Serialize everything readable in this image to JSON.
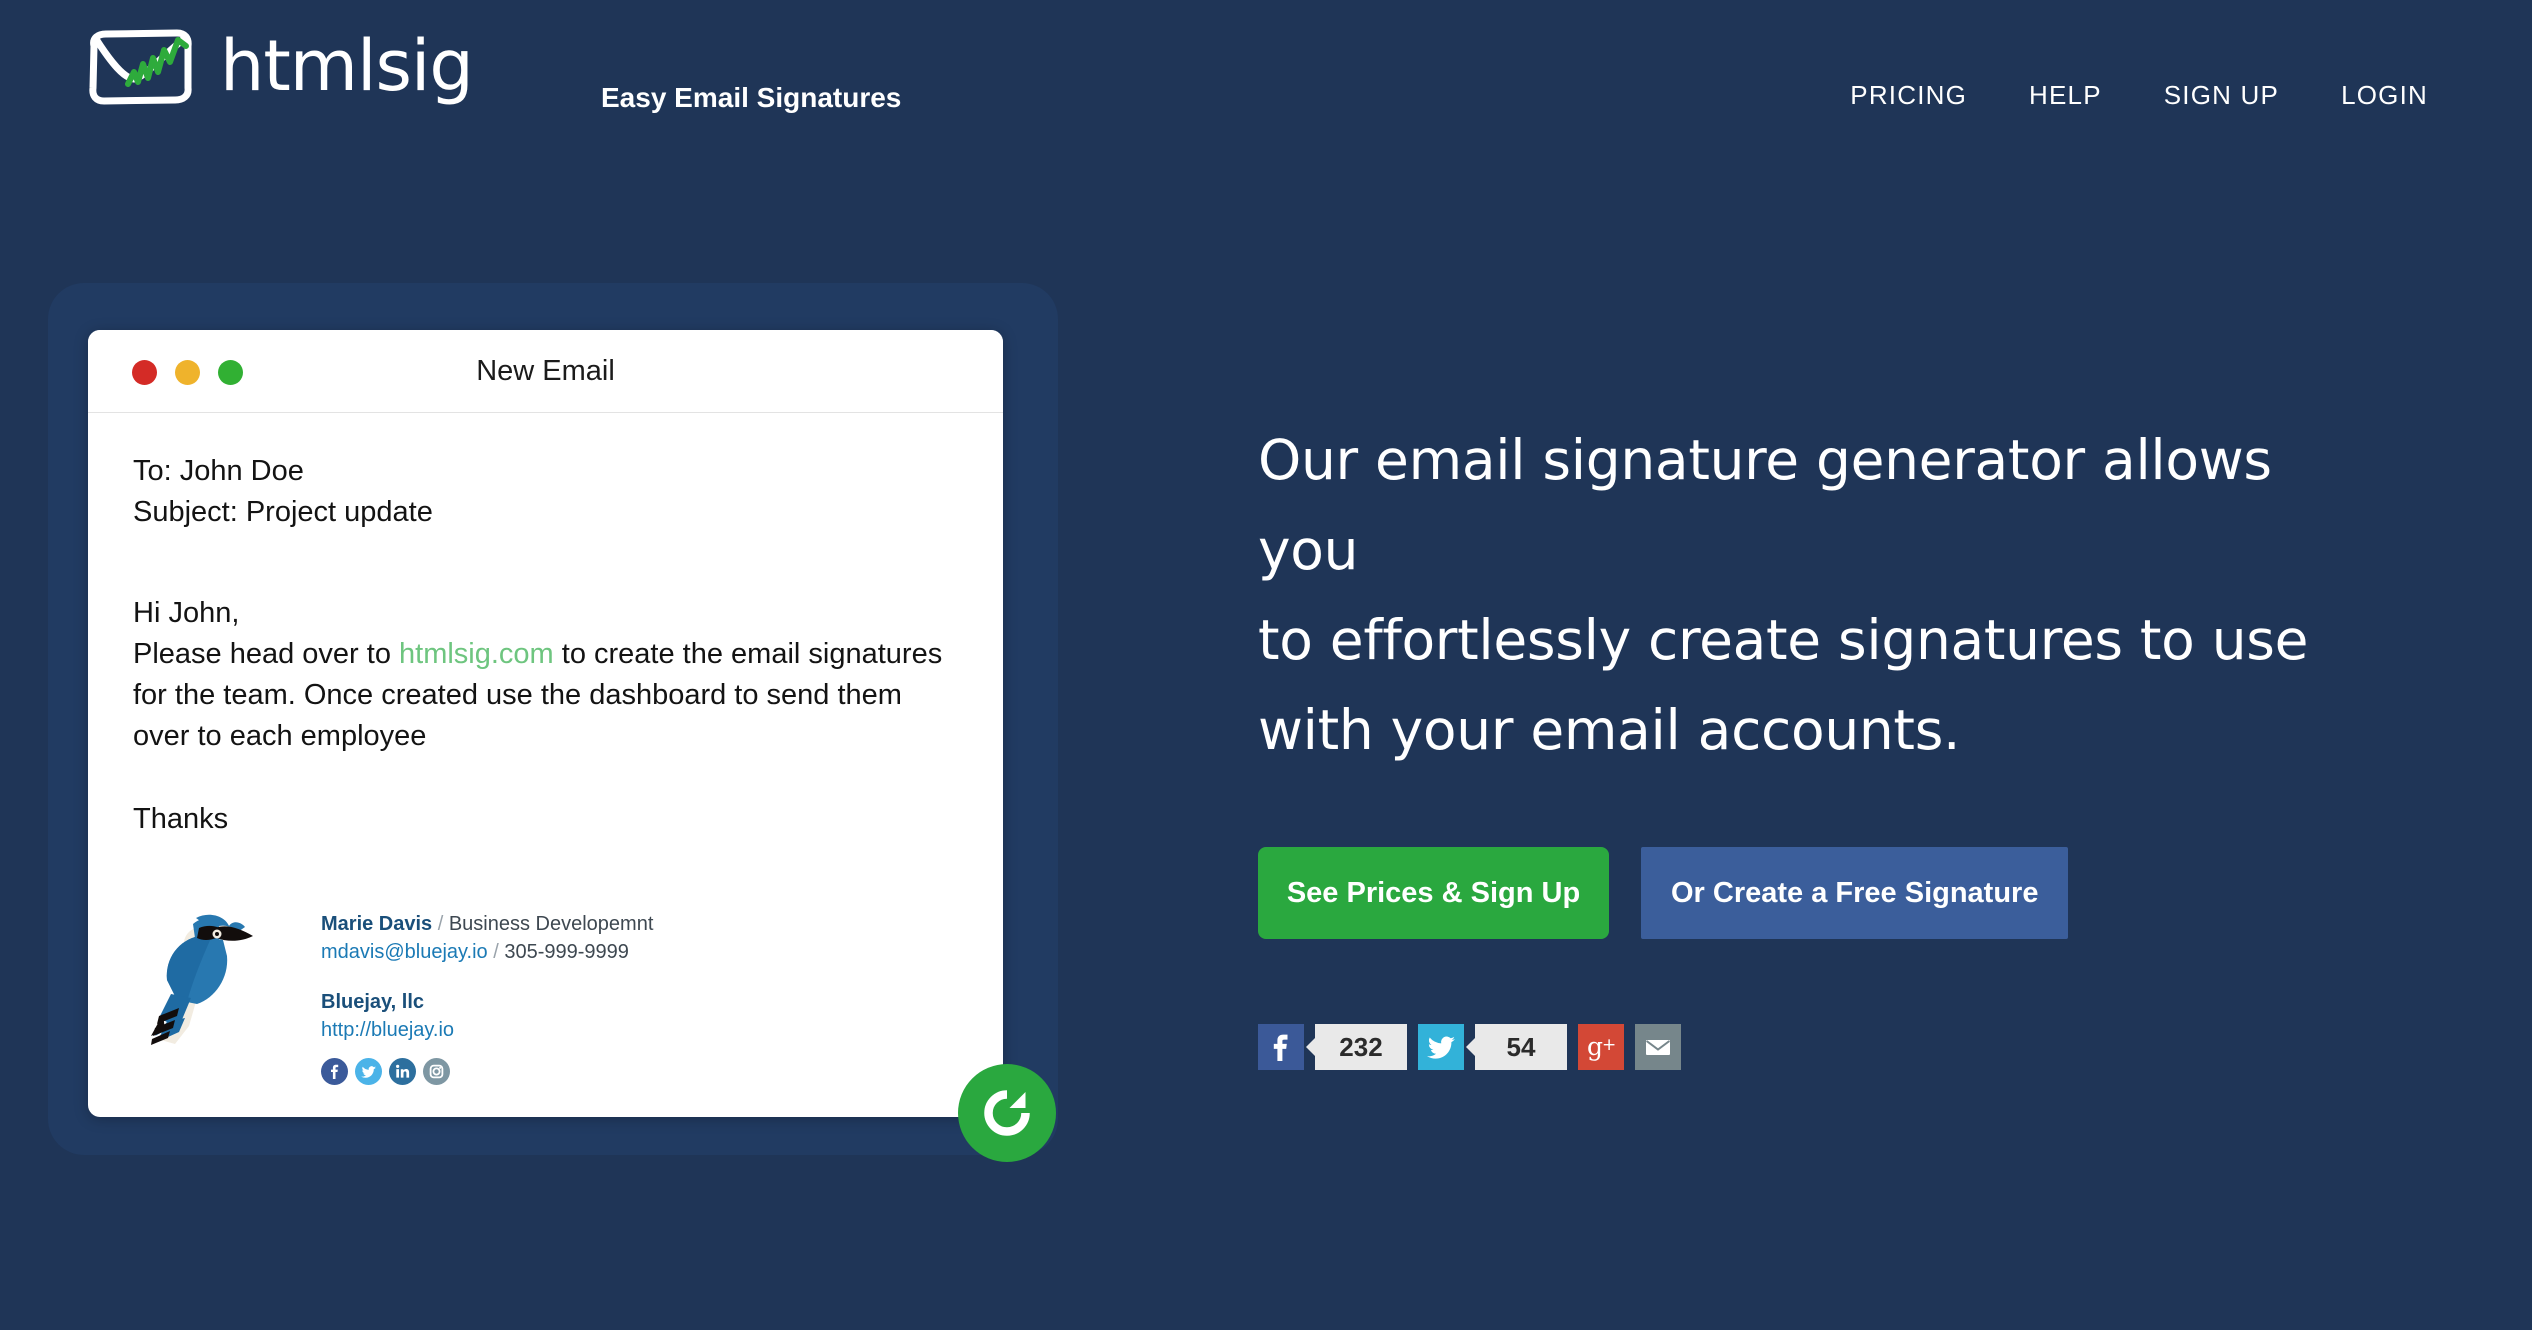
{
  "theme": {
    "bg": "#1f3557",
    "panel": "#23406c",
    "accent_green": "#2aa83f",
    "accent_blue": "#3b5e9b",
    "link_green": "#6ec57f",
    "sig_link_blue": "#1b7ab5"
  },
  "header": {
    "logo_word": "htmlsig",
    "logo_icon": "envelope-chart-logo",
    "tagline": "Easy Email Signatures",
    "nav": [
      {
        "label": "PRICING"
      },
      {
        "label": "HELP"
      },
      {
        "label": "SIGN UP"
      },
      {
        "label": "LOGIN"
      }
    ]
  },
  "email_preview": {
    "window_title": "New Email",
    "traffic_lights": [
      "close-red",
      "minimize-yellow",
      "maximize-green"
    ],
    "to_line": "To: John Doe",
    "subject_line": "Subject: Project update",
    "greeting": "Hi John,",
    "body_before_link": "Please head over to ",
    "body_link": "htmlsig.com",
    "body_after_link": " to create the email signatures for the team. Once created use the dashboard to send them over to each employee",
    "closing": "Thanks",
    "refresh_icon": "refresh-icon",
    "signature": {
      "avatar_icon": "bluejay-bird-logo",
      "name": "Marie Davis",
      "separator": " / ",
      "job_title": "Business Developemnt",
      "email": "mdavis@bluejay.io",
      "phone": "305-999-9999",
      "company": "Bluejay, llc",
      "website": "http://bluejay.io",
      "social": [
        {
          "name": "facebook-icon",
          "color": "#3b5a9a"
        },
        {
          "name": "twitter-icon",
          "color": "#4bb3e8"
        },
        {
          "name": "linkedin-icon",
          "color": "#2d6f9e"
        },
        {
          "name": "instagram-icon",
          "color": "#7e97a3"
        }
      ]
    }
  },
  "hero": {
    "headline_line_1": "Our email signature generator allows you",
    "headline_line_2": "to effortlessly create signatures to use",
    "headline_line_3": "with your email accounts.",
    "cta_primary": "See Prices & Sign Up",
    "cta_secondary": "Or Create a Free Signature",
    "share": {
      "facebook_icon": "facebook-icon",
      "facebook_count": "232",
      "twitter_icon": "twitter-icon",
      "twitter_count": "54",
      "googleplus_icon": "google-plus-icon",
      "email_icon": "email-icon"
    }
  }
}
